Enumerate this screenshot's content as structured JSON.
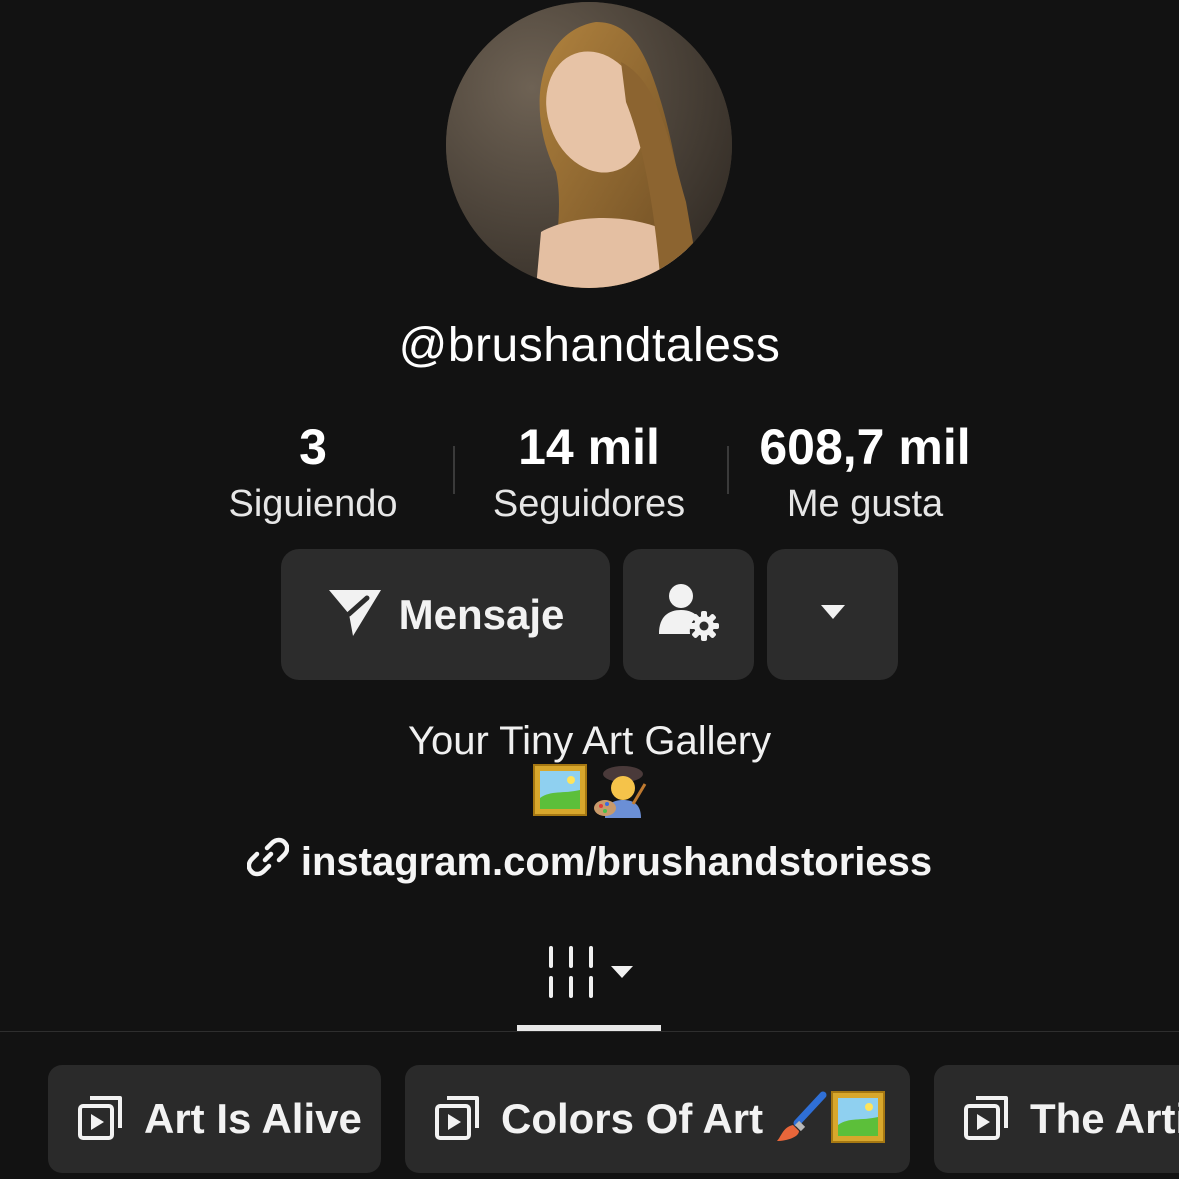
{
  "profile": {
    "username": "@brushandtaless",
    "avatar_description": "portrait-painting"
  },
  "stats": [
    {
      "value": "3",
      "label": "Siguiendo"
    },
    {
      "value": "14 mil",
      "label": "Seguidores"
    },
    {
      "value": "608,7 mil",
      "label": "Me gusta"
    }
  ],
  "actions": {
    "message_label": "Mensaje",
    "message_icon": "send-icon",
    "user_settings_icon": "user-gear-icon",
    "more_icon": "caret-down-icon"
  },
  "bio": {
    "text": "Your Tiny Art Gallery",
    "emojis": [
      "framed-picture-emoji",
      "artist-emoji"
    ]
  },
  "link": {
    "icon": "link-icon",
    "text": "instagram.com/brushandstoriess"
  },
  "tabs": {
    "active_icon": "videos-grid-icon",
    "dropdown_icon": "caret-down-icon"
  },
  "playlists": [
    {
      "label": "Art Is Alive",
      "icon": "playlist-icon"
    },
    {
      "label": "Colors Of Art",
      "icon": "playlist-icon",
      "emojis": [
        "paintbrush-emoji",
        "framed-picture-emoji"
      ]
    },
    {
      "label": "The Arti",
      "icon": "playlist-icon"
    }
  ],
  "colors": {
    "background": "#121212",
    "button": "#2c2c2c",
    "text": "#ffffff",
    "muted": "#e6e6e6"
  }
}
